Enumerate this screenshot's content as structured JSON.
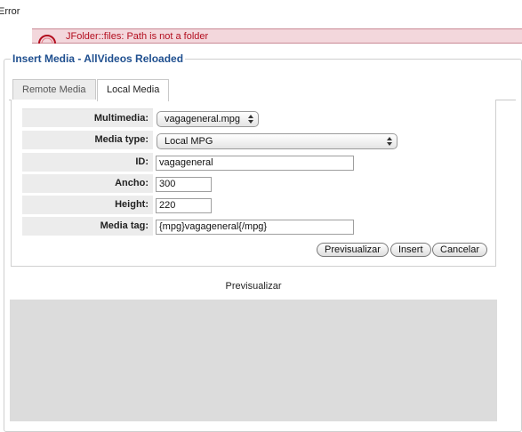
{
  "page": {
    "error_title": "Error",
    "error_message": "JFolder::files: Path is not a folder"
  },
  "dialog": {
    "legend": "Insert Media - AllVideos Reloaded",
    "tabs": [
      {
        "label": "Remote Media",
        "active": false
      },
      {
        "label": "Local Media",
        "active": true
      }
    ]
  },
  "form": {
    "multimedia": {
      "label": "Multimedia:",
      "value": "vagageneral.mpg"
    },
    "media_type": {
      "label": "Media type:",
      "value": "Local MPG"
    },
    "id": {
      "label": "ID:",
      "value": "vagageneral"
    },
    "ancho": {
      "label": "Ancho:",
      "value": "300"
    },
    "height": {
      "label": "Height:",
      "value": "220"
    },
    "media_tag": {
      "label": "Media tag:",
      "value": "{mpg}vagageneral{/mpg}"
    }
  },
  "buttons": {
    "preview": "Previsualizar",
    "insert": "Insert",
    "cancel": "Cancelar"
  },
  "preview": {
    "title": "Previsualizar"
  },
  "colors": {
    "error_text": "#b30e1f",
    "error_bg": "#f3d7dc",
    "legend": "#1f4f8f",
    "label_bg": "#ececec",
    "preview_bg": "#dcdcdc"
  }
}
